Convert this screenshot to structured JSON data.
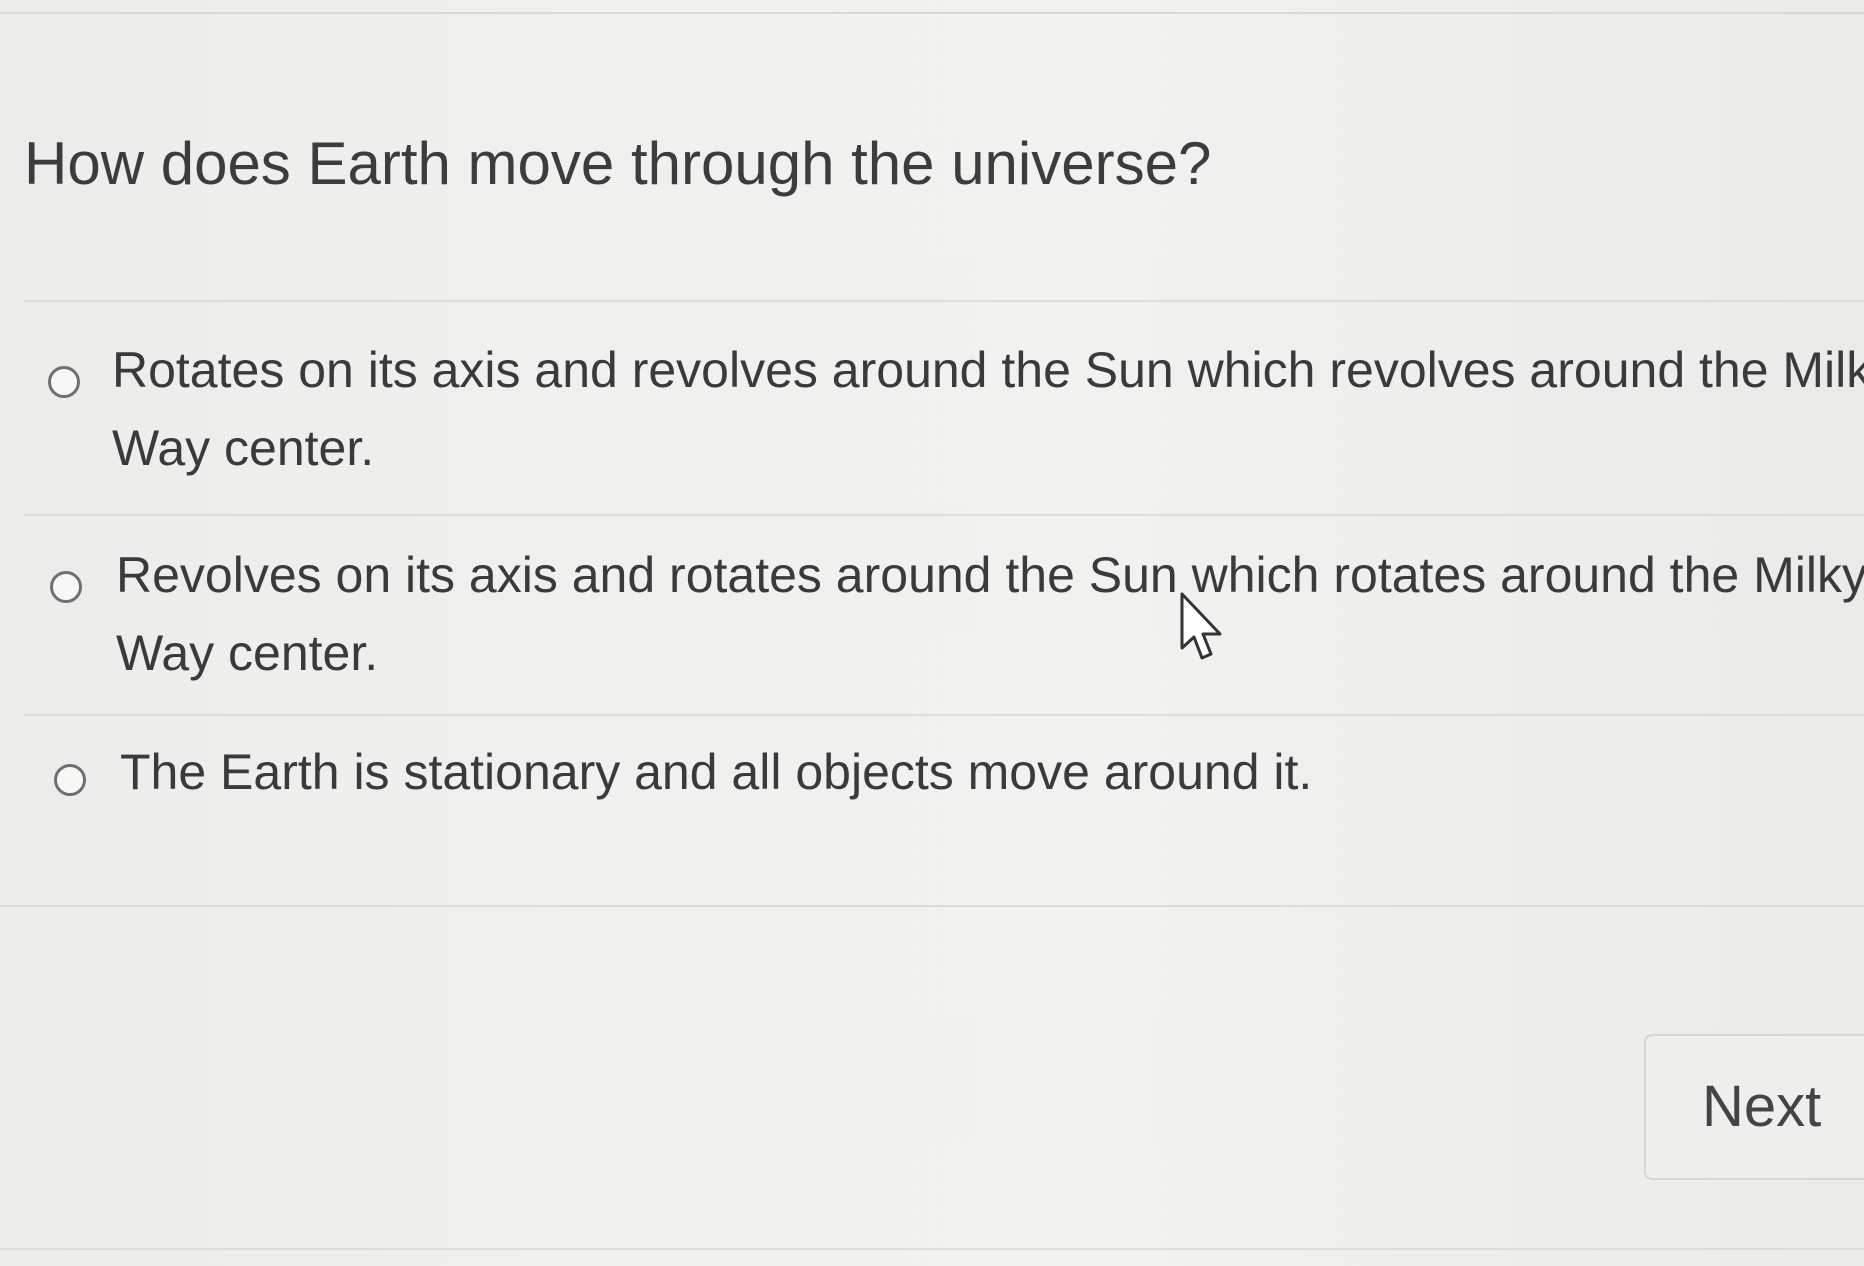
{
  "question": {
    "text": "How does Earth move through the universe?"
  },
  "options": [
    {
      "line1": "Rotates on its axis and revolves around the Sun which revolves around the Milky",
      "line2": "Way center.",
      "selected": false
    },
    {
      "line1": "Revolves on its axis and rotates around the Sun which rotates around the Milky",
      "line2": "Way center.",
      "selected": false
    },
    {
      "line1": "The Earth is stationary and all objects move around it.",
      "selected": false
    }
  ],
  "navigation": {
    "next_label": "Next"
  },
  "icons": {
    "radio": "radio-unselected-icon",
    "cursor": "mouse-pointer-icon"
  }
}
